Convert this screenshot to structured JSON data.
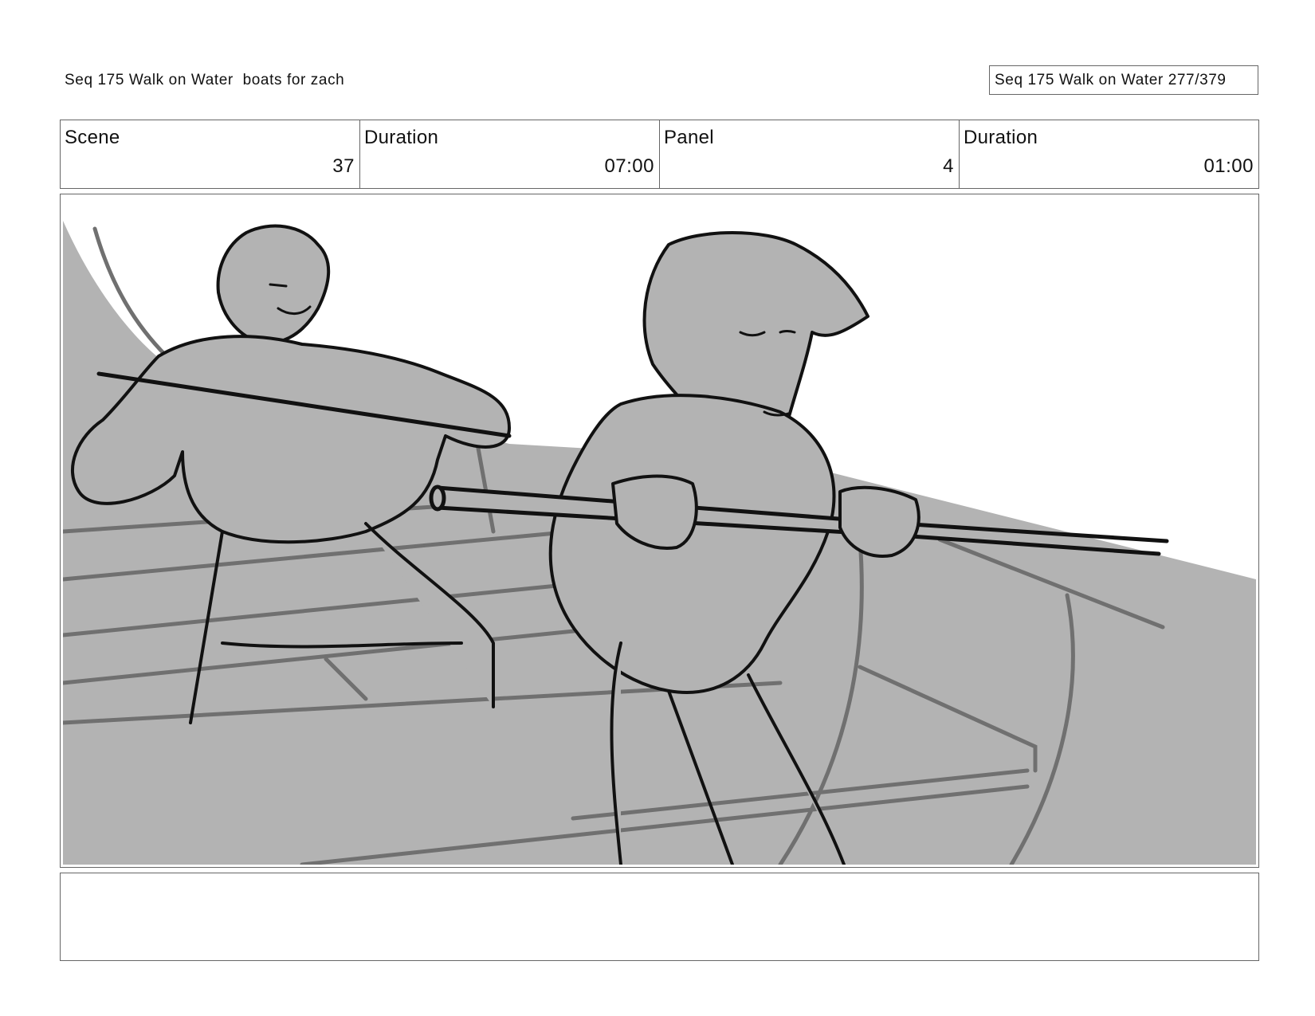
{
  "header": {
    "title": "Seq 175 Walk on Water  boats for zach",
    "page_info": "Seq 175 Walk on Water 277/379"
  },
  "info": {
    "scene_label": "Scene",
    "scene_value": "37",
    "scene_duration_label": "Duration",
    "scene_duration_value": "07:00",
    "panel_label": "Panel",
    "panel_value": "4",
    "panel_duration_label": "Duration",
    "panel_duration_value": "01:00"
  },
  "panel": {
    "description_icon": "storyboard-sketch-two-characters-rowing-boat",
    "tone_color": "#b3b3b3",
    "line_color": "#111111"
  },
  "notes": {
    "text": ""
  }
}
